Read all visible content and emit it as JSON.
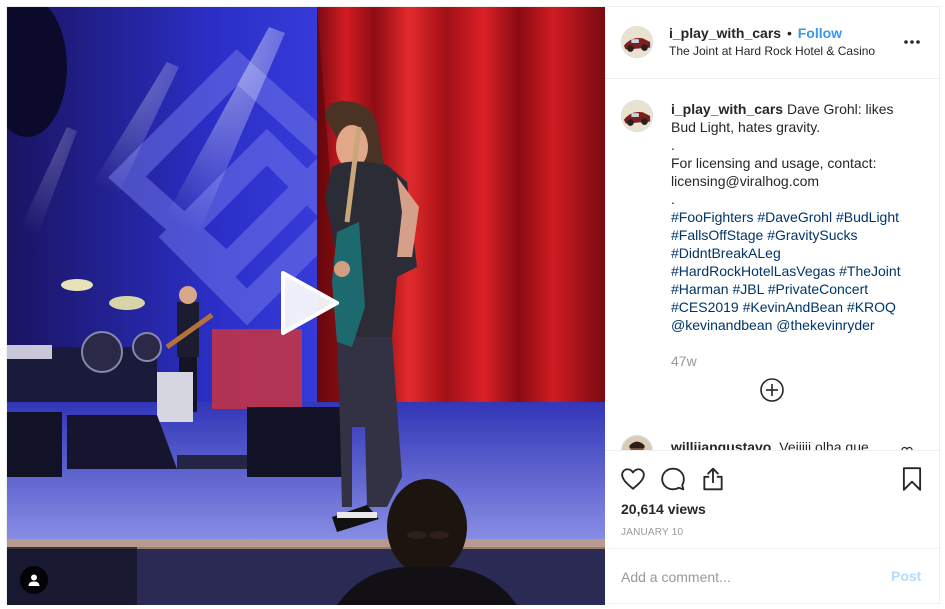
{
  "colors": {
    "accent": "#3897f0",
    "hashtag": "#003569",
    "muted": "#999999",
    "post_disabled": "#b3dbff",
    "border": "#efefef"
  },
  "header": {
    "username": "i_play_with_cars",
    "separator": "•",
    "follow_label": "Follow",
    "location": "The Joint at Hard Rock Hotel & Casino"
  },
  "caption": {
    "username": "i_play_with_cars",
    "text_line1": "Dave Grohl: likes Bud Light, hates gravity.",
    "dot1": ".",
    "text_line2": "For licensing and usage, contact: licensing@viralhog.com",
    "dot2": ".",
    "hashtags": [
      "#FooFighters",
      "#DaveGrohl",
      "#BudLight",
      "#FallsOffStage",
      "#GravitySucks",
      "#DidntBreakALeg",
      "#HardRockHotelLasVegas",
      "#TheJoint",
      "#Harman",
      "#JBL",
      "#PrivateConcert",
      "#CES2019",
      "#KevinAndBean",
      "#KROQ"
    ],
    "mentions": [
      "@kevinandbean",
      "@thekevinryder"
    ],
    "age": "47w"
  },
  "comments": [
    {
      "username": "williiangustavo",
      "text": "Veiiiii olha que"
    }
  ],
  "icons": {
    "more": "more-options-icon",
    "play": "play-icon",
    "tag": "user-tag-icon",
    "load_more": "plus-circle-icon",
    "like": "heart-icon",
    "comment": "comment-bubble-icon",
    "share": "share-icon",
    "save": "bookmark-icon"
  },
  "stats": {
    "views": "20,614 views",
    "date": "JANUARY 10"
  },
  "add_comment": {
    "placeholder": "Add a comment...",
    "post_label": "Post"
  }
}
